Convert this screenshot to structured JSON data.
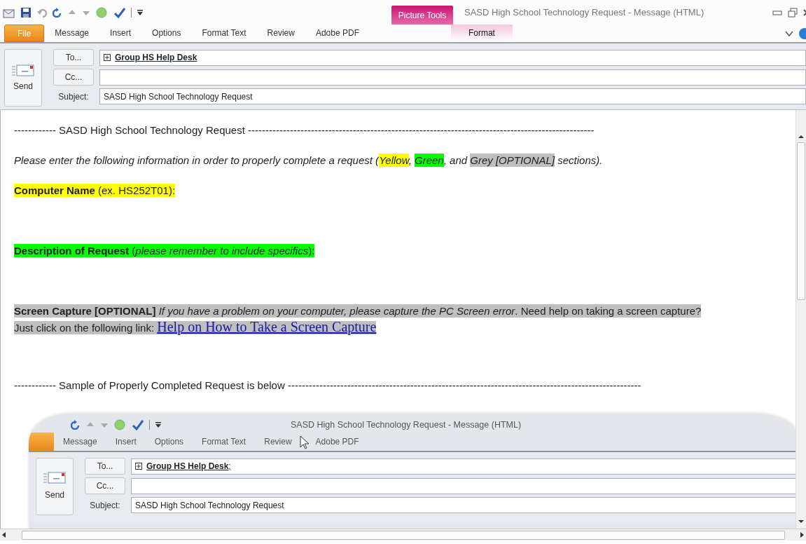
{
  "window": {
    "title": "SASD High School Technology Request  -  Message (HTML)"
  },
  "ribbon_tabs": [
    {
      "label": "File",
      "kind": "file"
    },
    {
      "label": "Message",
      "kind": "normal"
    },
    {
      "label": "Insert",
      "kind": "normal"
    },
    {
      "label": "Options",
      "kind": "normal"
    },
    {
      "label": "Format Text",
      "kind": "normal"
    },
    {
      "label": "Review",
      "kind": "normal"
    },
    {
      "label": "Adobe PDF",
      "kind": "normal"
    }
  ],
  "contextual_tabs": {
    "group": "Picture Tools",
    "tabs": [
      {
        "label": "Format",
        "kind": "contextual"
      }
    ]
  },
  "header": {
    "send": "Send",
    "to_button": "To...",
    "to": "Group HS Help Desk",
    "cc_button": "Cc...",
    "subject_label": "Subject:",
    "subject": "SASD High School Technology Request"
  },
  "body": {
    "heading": "------------ SASD High School Technology Request ---------------------------------------------------------------------------------------------------",
    "intro": [
      {
        "text": "Please enter the following information in order to properly complete a request ("
      },
      {
        "text": "Yellow",
        "color": "#ffff00"
      },
      {
        "text": ", "
      },
      {
        "text": "Green",
        "color": "#00ff00"
      },
      {
        "text": ", and "
      },
      {
        "text": "Grey [OPTIONAL]",
        "color": "#bfbfbf"
      },
      {
        "text": " sections)."
      }
    ],
    "sections": [
      {
        "text": "**Computer Name** (ex. HS252T01):",
        "color": "#ffff00"
      },
      {
        "text": "**Description of Request** (*please remember to include specifics*):",
        "color": "#00ff00"
      },
      {
        "text": "**Screen Capture [OPTIONAL]** *If you have a problem on your computer, please capture the PC Screen error*. Need help on taking a screen capture?",
        "color": "#bfbfbf",
        "line2": "Just click on the following link:",
        "link": "Help on How to Take a Screen Capture"
      }
    ],
    "sample_heading": "------------ Sample of Properly Completed Request is below -----------------------------------------------------------------------------------------------------"
  },
  "sample_screenshot": {
    "title": "SASD High School Technology Request  -  Message (HTML)",
    "tabs": [
      "Message",
      "Insert",
      "Options",
      "Format Text",
      "Review",
      "Adobe PDF"
    ],
    "send": "Send",
    "to_button": "To...",
    "to": "Group HS Help Desk",
    "to_suffix": ";",
    "cc_button": "Cc...",
    "subject_label": "Subject:",
    "subject": "SASD High School Technology Request"
  }
}
